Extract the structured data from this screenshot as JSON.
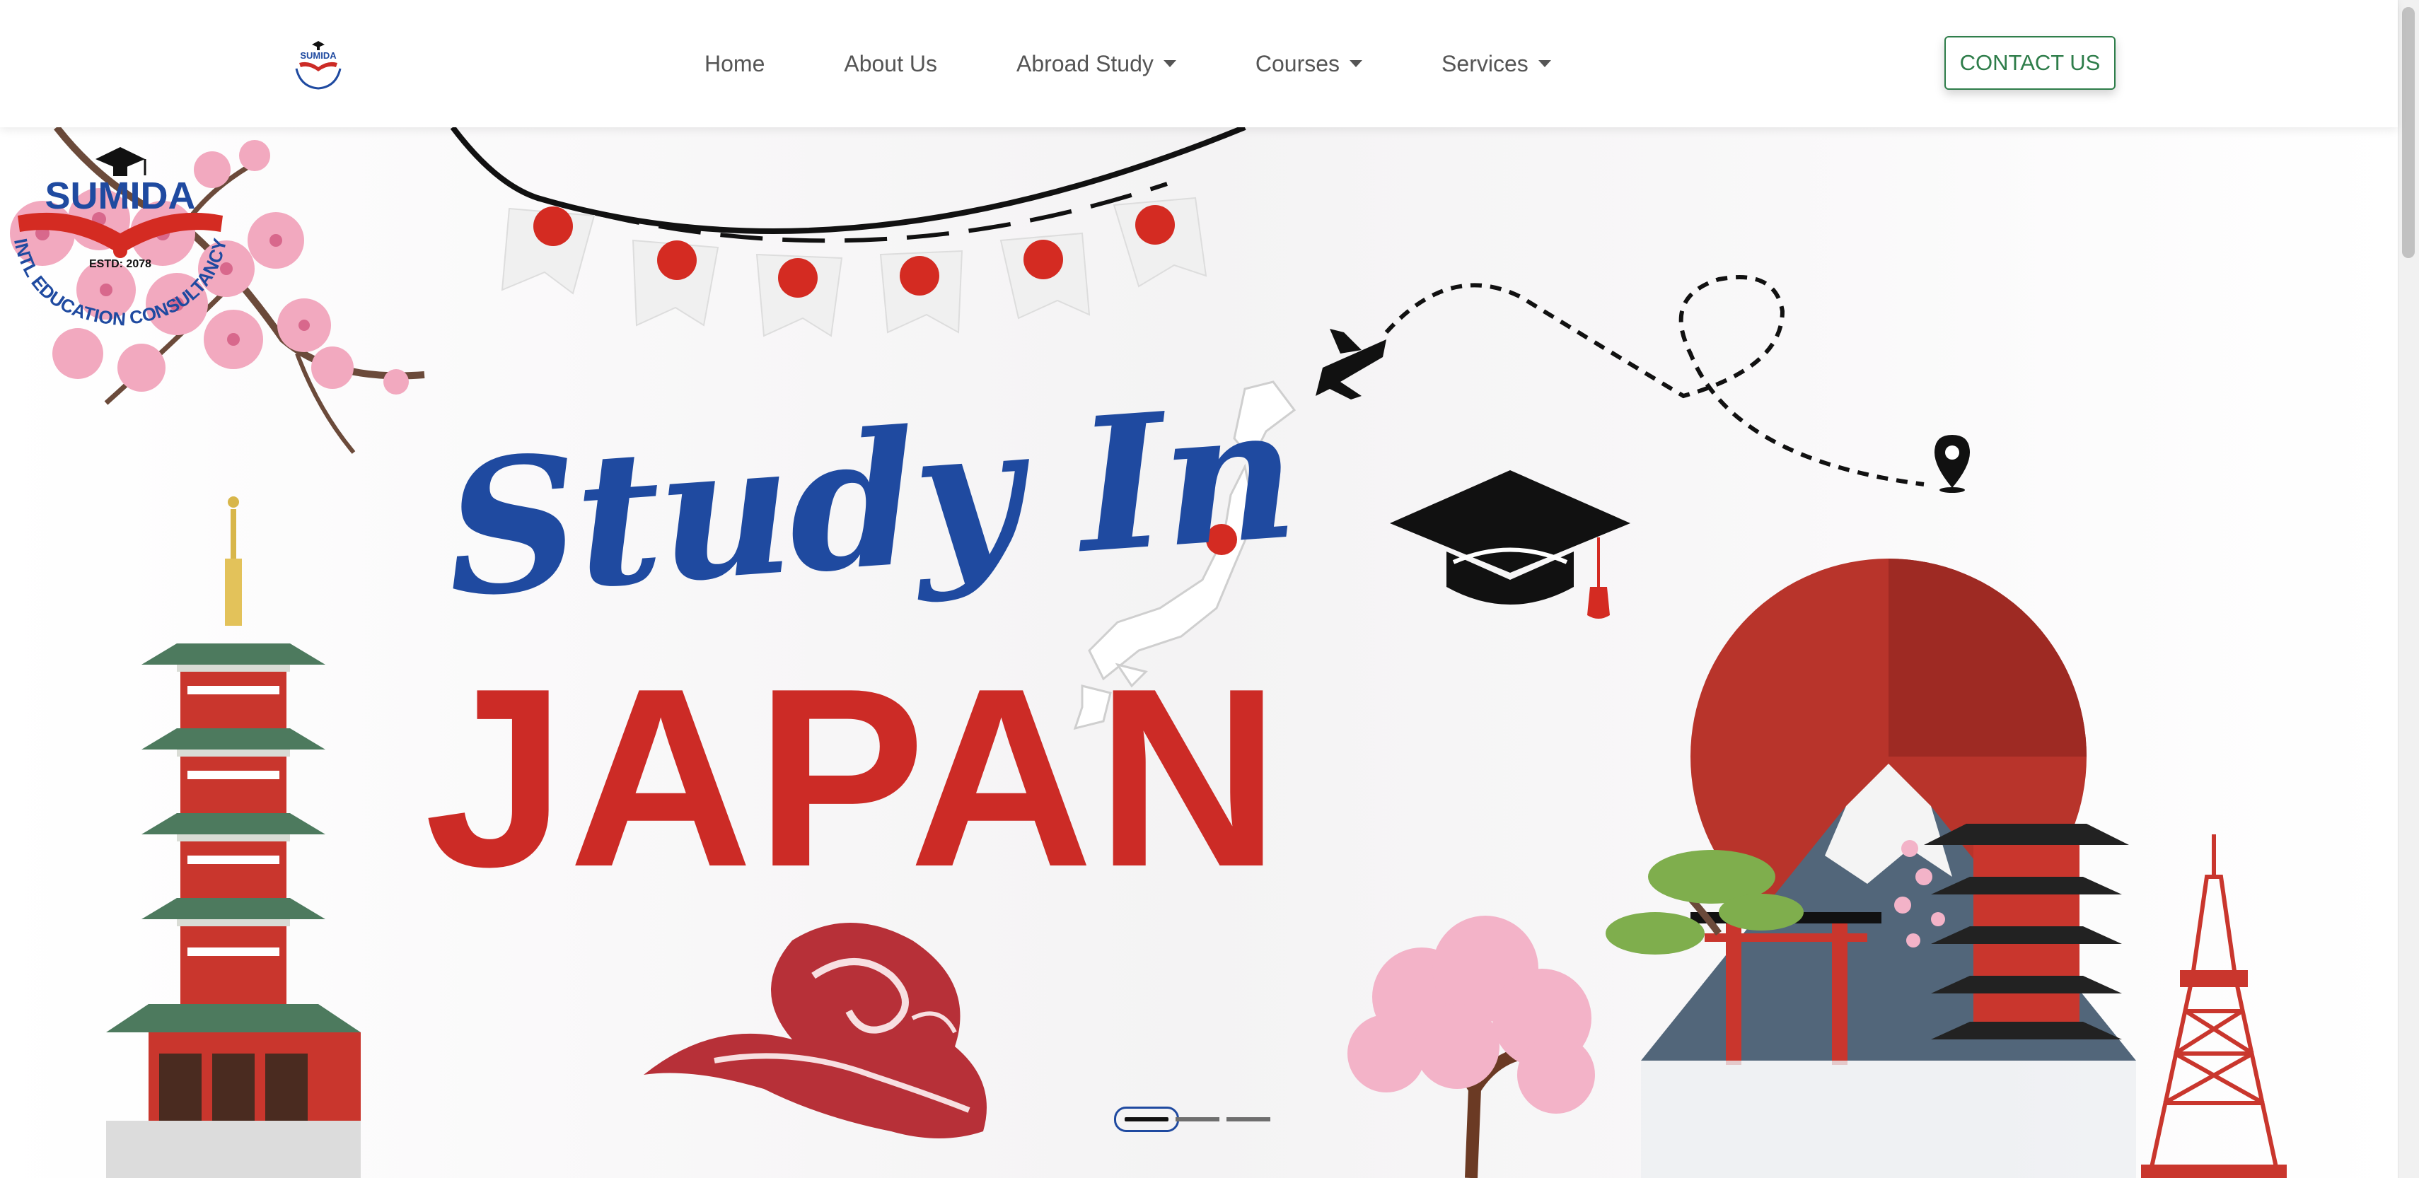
{
  "nav": {
    "items": [
      {
        "label": "Home",
        "dropdown": false
      },
      {
        "label": "About Us",
        "dropdown": false
      },
      {
        "label": "Abroad Study",
        "dropdown": true
      },
      {
        "label": "Courses",
        "dropdown": true
      },
      {
        "label": "Services",
        "dropdown": true
      }
    ],
    "contact_label": "CONTACT US"
  },
  "brand": {
    "name": "SUMIDA",
    "tagline": "INTL EDUCATION CONSULTANCY",
    "established": "ESTD: 2078"
  },
  "hero": {
    "line1": "Study In",
    "line2": "JAPAN"
  },
  "carousel": {
    "slides": 3,
    "active": 0
  },
  "colors": {
    "accent_green": "#2e7d4a",
    "brand_blue": "#1f4aa0",
    "japan_red": "#cc2b26"
  },
  "icons": [
    "cherry-blossom-icon",
    "pagoda-icon",
    "airplane-icon",
    "location-pin-icon",
    "graduation-cap-icon",
    "japan-map-icon",
    "mount-fuji-icon",
    "tokyo-tower-icon",
    "wave-icon",
    "flag-bunting-icon"
  ]
}
